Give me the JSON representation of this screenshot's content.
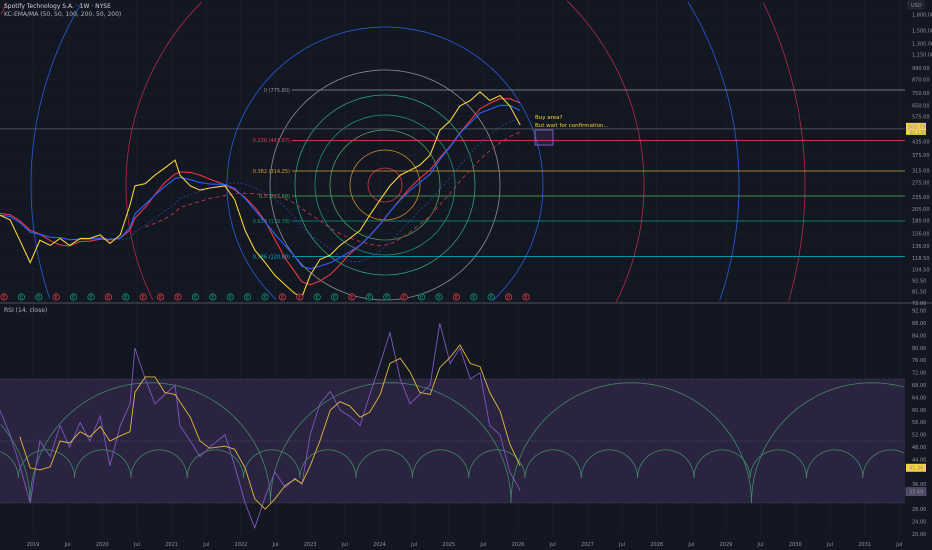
{
  "header": {
    "symbol_title": "Spotify Technology S.A. · 1W · NYSE",
    "indicator_title": "KC-EMA/MA (50, 50, 100, 200, 50, 200)",
    "rsi_title": "RSI (14, close)",
    "currency": "USD"
  },
  "annotation": {
    "line1": "Buy area?",
    "line2": "But wait for confirmation..."
  },
  "colors": {
    "background": "#131722",
    "price": "#f5d33a",
    "ema": "#2962ff",
    "ma": "#e53945",
    "rsi": "#7e57c2",
    "rsi_ma": "#e2b93b",
    "rsi_band": "#2a2440",
    "cycle": "#3f8a67"
  },
  "chart_data": [
    {
      "type": "line",
      "title": "Spotify Technology S.A. · 1W · NYSE",
      "ylabel": "USD",
      "yscale": "log",
      "ylim": [
        72,
        1800
      ],
      "xlim": [
        2018.52,
        2031.75
      ],
      "x": [
        2018.52,
        2018.67,
        2018.81,
        2018.96,
        2019.1,
        2019.25,
        2019.39,
        2019.53,
        2019.68,
        2019.82,
        2019.97,
        2020.11,
        2020.26,
        2020.4,
        2020.47,
        2020.62,
        2020.76,
        2020.9,
        2021.05,
        2021.12,
        2021.27,
        2021.41,
        2021.55,
        2021.77,
        2021.91,
        2022.06,
        2022.2,
        2022.35,
        2022.49,
        2022.64,
        2022.78,
        2022.88,
        2023.0,
        2023.14,
        2023.29,
        2023.43,
        2023.57,
        2023.72,
        2023.86,
        2024.01,
        2024.15,
        2024.3,
        2024.44,
        2024.58,
        2024.73,
        2024.87,
        2025.02,
        2025.16,
        2025.31,
        2025.45,
        2025.59,
        2025.74,
        2025.88,
        2026.03
      ],
      "series": [
        {
          "name": "Close",
          "values": [
            192,
            182,
            145,
            113,
            145,
            137,
            148,
            137,
            148,
            148,
            154,
            140,
            154,
            215,
            266,
            273,
            300,
            325,
            355,
            300,
            266,
            254,
            260,
            266,
            228,
            162,
            130,
            113,
            98,
            88,
            80,
            77,
            98,
            117,
            123,
            137,
            148,
            162,
            192,
            228,
            266,
            300,
            317,
            335,
            375,
            495,
            550,
            650,
            690,
            760,
            690,
            730,
            650,
            525
          ]
        }
      ],
      "last_price": "502.79",
      "last_price_sub": "3d 13h",
      "price_ticks": [
        "1,800.00",
        "1,500.00",
        "1,300.00",
        "1,150.00",
        "990.00",
        "870.00",
        "750.00",
        "650.00",
        "575.00",
        "435.00",
        "375.00",
        "315.00",
        "275.00",
        "235.00",
        "205.00",
        "180.00",
        "156.00",
        "136.00",
        "118.50",
        "104.50",
        "92.50",
        "81.50",
        "72.00"
      ],
      "price_tick_values": [
        1800,
        1500,
        1300,
        1150,
        990,
        870,
        750,
        650,
        575,
        435,
        375,
        315,
        275,
        235,
        205,
        180,
        156,
        136,
        118.5,
        104.5,
        92.5,
        81.5,
        72
      ],
      "fib_levels": [
        {
          "label": "0 (775.80)",
          "value": 775.8,
          "color": "#9598a1"
        },
        {
          "label": "0.236 (441.87)",
          "value": 441.87,
          "color": "#e53945"
        },
        {
          "label": "0.382 (314.25)",
          "value": 314.25,
          "color": "#d9a12b"
        },
        {
          "label": "0.5 (237.68)",
          "value": 237.68,
          "color": "#4caf50"
        },
        {
          "label": "0.618 (179.78)",
          "value": 179.78,
          "color": "#089981"
        },
        {
          "label": "0.786 (120.80)",
          "value": 120.8,
          "color": "#00bcd4"
        }
      ],
      "earnings": [
        "miss",
        "beat",
        "beat",
        "miss",
        "beat",
        "beat",
        "miss",
        "beat",
        "miss",
        "miss",
        "miss",
        "beat",
        "beat",
        "beat",
        "beat",
        "beat",
        "miss",
        "miss",
        "beat",
        "beat",
        "miss",
        "beat",
        "beat",
        "miss",
        "beat",
        "beat",
        "miss",
        "beat",
        "beat",
        "miss",
        "miss"
      ],
      "earnings_glyph": "E"
    },
    {
      "type": "line",
      "title": "RSI (14, close)",
      "ylim": [
        20,
        92
      ],
      "series": [
        {
          "name": "RSI",
          "values": [
            60,
            52,
            42,
            30,
            50,
            45,
            55,
            48,
            56,
            50,
            58,
            42,
            55,
            62,
            80,
            70,
            62,
            65,
            68,
            55,
            50,
            45,
            48,
            52,
            42,
            30,
            22,
            32,
            40,
            35,
            38,
            36,
            52,
            62,
            66,
            60,
            58,
            55,
            65,
            75,
            85,
            70,
            62,
            65,
            68,
            88,
            75,
            80,
            70,
            72,
            55,
            52,
            40,
            34
          ]
        }
      ],
      "bands": [
        30,
        50,
        70
      ],
      "rsi_ticks": [
        "92.00",
        "88.00",
        "84.00",
        "80.00",
        "76.00",
        "72.00",
        "68.00",
        "64.00",
        "60.00",
        "56.00",
        "52.00",
        "48.00",
        "44.00",
        "36.00",
        "28.00",
        "24.00",
        "20.00"
      ],
      "rsi_tick_values": [
        92,
        88,
        84,
        80,
        76,
        72,
        68,
        64,
        60,
        56,
        52,
        48,
        44,
        36,
        28,
        24,
        20
      ],
      "rsi_ma_last": "41.36",
      "rsi_last": "33.69"
    }
  ],
  "time_axis": {
    "labels": [
      "2019",
      "Jul",
      "2020",
      "Jul",
      "2021",
      "Jul",
      "2022",
      "Jul",
      "2023",
      "Jul",
      "2024",
      "Jul",
      "2025",
      "Jul",
      "2026",
      "Jul",
      "2027",
      "Jul",
      "2028",
      "Jul",
      "2029",
      "Jul",
      "2030",
      "Jul",
      "2031",
      "Jul"
    ],
    "values": [
      2019,
      2019.5,
      2020,
      2020.5,
      2021,
      2021.5,
      2022,
      2022.5,
      2023,
      2023.5,
      2024,
      2024.5,
      2025,
      2025.5,
      2026,
      2026.5,
      2027,
      2027.5,
      2028,
      2028.5,
      2029,
      2029.5,
      2030,
      2030.5,
      2031,
      2031.5
    ]
  }
}
